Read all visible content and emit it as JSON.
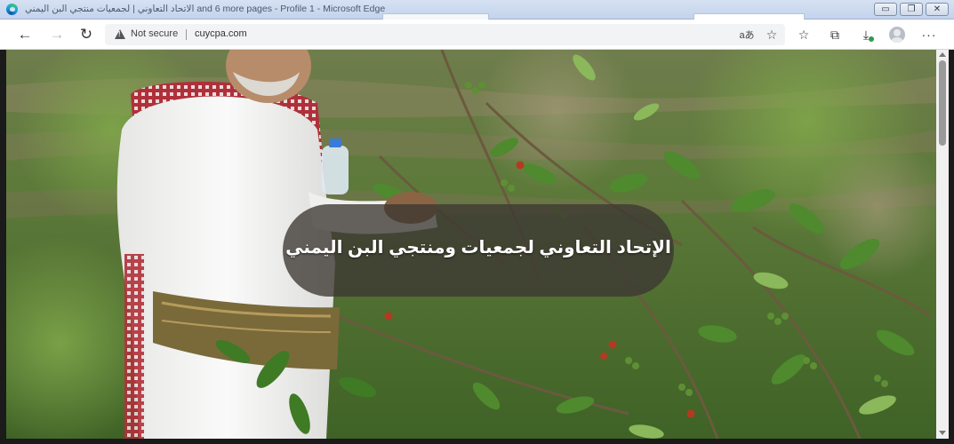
{
  "window": {
    "title": "الاتحاد التعاوني | لجمعيات منتجي البن اليمني and 6 more pages - Profile 1 - Microsoft Edge",
    "buttons": {
      "minimize": "▭",
      "restore": "❐",
      "close": "✕"
    }
  },
  "toolbar": {
    "back": "←",
    "forward": "→",
    "refresh": "↻",
    "security_label": "Not secure",
    "url": "cuycpa.com",
    "read_aloud": "aあ",
    "add_favorite": "☆",
    "favorites": "☆",
    "collections": "⧉",
    "downloads": "⤓",
    "more": "···"
  },
  "hero": {
    "title": "الإتحاد التعاوني لجمعيات ومنتجي البن اليمني"
  },
  "colors": {
    "caption_bg": "#3c3732",
    "foliage_dark": "#2f4a22",
    "foliage_light": "#8bb85a",
    "coffee_cherry_red": "#b33a20",
    "robe_white": "#f4f4f2",
    "scarf_red": "#b0303a"
  }
}
